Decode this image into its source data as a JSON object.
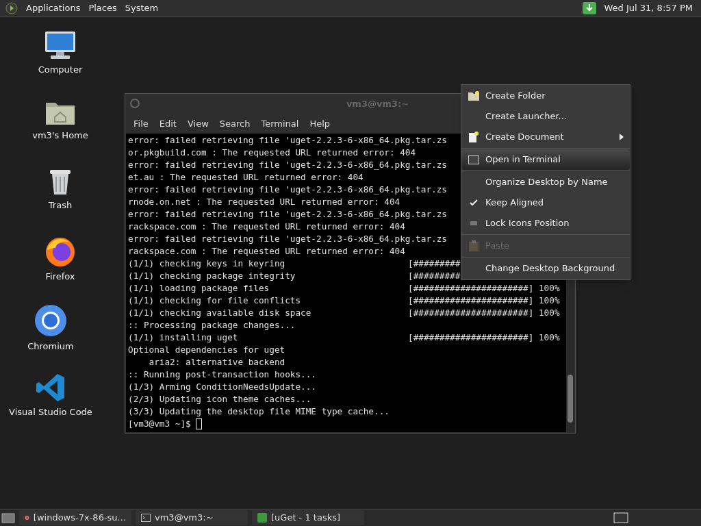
{
  "top_panel": {
    "menus": [
      "Applications",
      "Places",
      "System"
    ],
    "clock": "Wed Jul 31, 8:57 PM"
  },
  "desktop_icons": [
    {
      "kind": "computer",
      "label": "Computer"
    },
    {
      "kind": "home",
      "label": "vm3's Home"
    },
    {
      "kind": "trash",
      "label": "Trash"
    },
    {
      "kind": "firefox",
      "label": "Firefox"
    },
    {
      "kind": "chromium",
      "label": "Chromium"
    },
    {
      "kind": "vscode",
      "label": "Visual Studio Code"
    }
  ],
  "terminal": {
    "title": "vm3@vm3:~",
    "menus": [
      "File",
      "Edit",
      "View",
      "Search",
      "Terminal",
      "Help"
    ],
    "lines": [
      {
        "text": "error: failed retrieving file 'uget-2.2.3-6-x86_64.pkg.tar.zs"
      },
      {
        "text": "or.pkgbuild.com : The requested URL returned error: 404"
      },
      {
        "text": "error: failed retrieving file 'uget-2.2.3-6-x86_64.pkg.tar.zs"
      },
      {
        "text": "et.au : The requested URL returned error: 404"
      },
      {
        "text": "error: failed retrieving file 'uget-2.2.3-6-x86_64.pkg.tar.zs"
      },
      {
        "text": "rnode.on.net : The requested URL returned error: 404"
      },
      {
        "text": "error: failed retrieving file 'uget-2.2.3-6-x86_64.pkg.tar.zs"
      },
      {
        "text": "rackspace.com : The requested URL returned error: 404"
      },
      {
        "text": "error: failed retrieving file 'uget-2.2.3-6-x86_64.pkg.tar.zs"
      },
      {
        "text": "rackspace.com : The requested URL returned error: 404"
      },
      {
        "text": "(1/1) checking keys in keyring",
        "bar": "[#########"
      },
      {
        "text": "(1/1) checking package integrity",
        "bar": "[#########"
      },
      {
        "text": "(1/1) loading package files",
        "bar": "[######################] 100%"
      },
      {
        "text": "(1/1) checking for file conflicts",
        "bar": "[######################] 100%"
      },
      {
        "text": "(1/1) checking available disk space",
        "bar": "[######################] 100%"
      },
      {
        "text": ":: Processing package changes..."
      },
      {
        "text": "(1/1) installing uget",
        "bar": "[######################] 100%"
      },
      {
        "text": "Optional dependencies for uget"
      },
      {
        "text": "    aria2: alternative backend"
      },
      {
        "text": ":: Running post-transaction hooks..."
      },
      {
        "text": "(1/3) Arming ConditionNeedsUpdate..."
      },
      {
        "text": "(2/3) Updating icon theme caches..."
      },
      {
        "text": "(3/3) Updating the desktop file MIME type cache..."
      }
    ],
    "prompt": "[vm3@vm3 ~]$"
  },
  "context_menu": {
    "sections": [
      [
        {
          "label": "Create Folder",
          "kind": "folder",
          "highlighted": false,
          "disabled": false,
          "checked": false,
          "submenu": false
        },
        {
          "label": "Create Launcher...",
          "kind": "plain",
          "highlighted": false,
          "disabled": false,
          "checked": false,
          "submenu": false
        },
        {
          "label": "Create Document",
          "kind": "document",
          "highlighted": false,
          "disabled": false,
          "checked": false,
          "submenu": true
        }
      ],
      [
        {
          "label": "Open in Terminal",
          "kind": "terminal",
          "highlighted": true,
          "disabled": false,
          "checked": false,
          "submenu": false
        }
      ],
      [
        {
          "label": "Organize Desktop by Name",
          "kind": "plain",
          "highlighted": false,
          "disabled": false,
          "checked": false,
          "submenu": false
        },
        {
          "label": "Keep Aligned",
          "kind": "plain",
          "highlighted": false,
          "disabled": false,
          "checked": true,
          "submenu": false
        },
        {
          "label": "Lock Icons Position",
          "kind": "lock",
          "highlighted": false,
          "disabled": false,
          "checked": false,
          "submenu": false
        }
      ],
      [
        {
          "label": "Paste",
          "kind": "paste",
          "highlighted": false,
          "disabled": true,
          "checked": false,
          "submenu": false
        }
      ],
      [
        {
          "label": "Change Desktop Background",
          "kind": "plain",
          "highlighted": false,
          "disabled": false,
          "checked": false,
          "submenu": false
        }
      ]
    ]
  },
  "taskbar": {
    "tasks": [
      {
        "kind": "firefox",
        "label": "[windows-7x-86-su..."
      },
      {
        "kind": "terminal",
        "label": "vm3@vm3:~"
      },
      {
        "kind": "uget",
        "label": "[uGet - 1 tasks]"
      }
    ]
  }
}
